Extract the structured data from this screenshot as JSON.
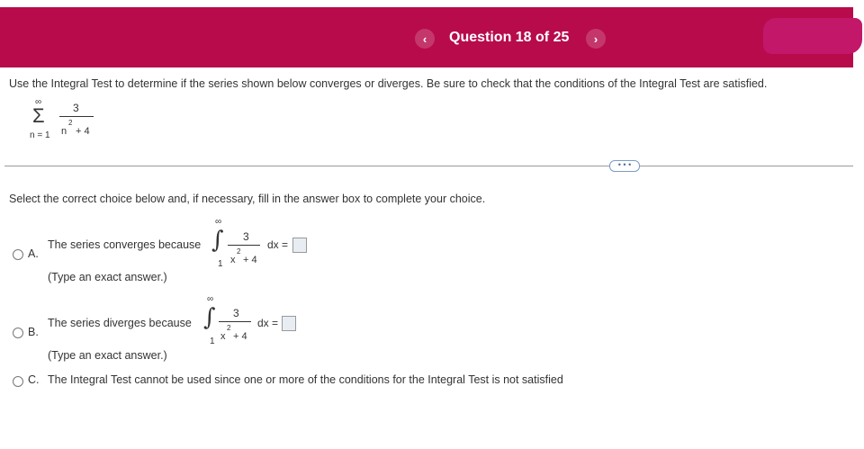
{
  "header": {
    "prev_icon": "chevron-left",
    "next_icon": "chevron-right",
    "question_counter": "Question 18 of 25"
  },
  "prompt": "Use the Integral Test to determine if the series shown below converges or diverges. Be sure to check that the conditions of the Integral Test are satisfied.",
  "series": {
    "sum_symbol": "Σ",
    "upper": "∞",
    "lower": "n = 1",
    "numerator": "3",
    "denominator_base": "n",
    "denominator_exp": "2",
    "denominator_rest": "+ 4"
  },
  "more_button": "• • •",
  "instruction": "Select the correct choice below and, if necessary, fill in the answer box to complete your choice.",
  "choices": {
    "a": {
      "letter": "A.",
      "text": "The series converges because",
      "upper": "∞",
      "lower": "1",
      "numerator": "3",
      "den_base": "x",
      "den_exp": "2",
      "den_rest": "+ 4",
      "dx": "dx =",
      "note": "(Type an exact answer.)"
    },
    "b": {
      "letter": "B.",
      "text": "The series diverges because",
      "upper": "∞",
      "lower": "1",
      "numerator": "3",
      "den_base": "x",
      "den_exp": "2",
      "den_rest": "+ 4",
      "dx": "dx =",
      "note": "(Type an exact answer.)"
    },
    "c": {
      "letter": "C.",
      "text": "The Integral Test cannot be used since one or more of the conditions for the Integral Test is not satisfied"
    }
  },
  "colors": {
    "header": "#b80b4b",
    "accent_blob": "#c3176a",
    "text": "#333333"
  }
}
